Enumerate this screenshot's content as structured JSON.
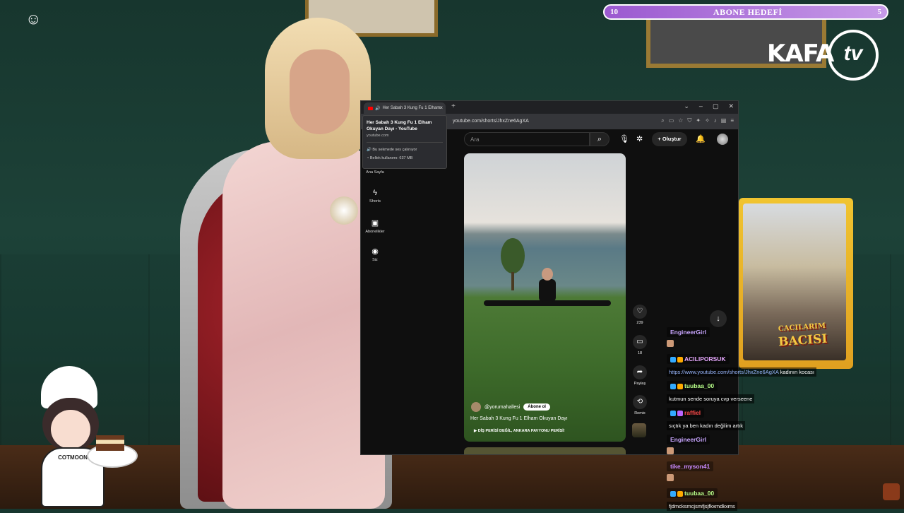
{
  "overlay": {
    "goal": {
      "current": "10",
      "title": "ABONE HEDEFİ",
      "target": "5"
    },
    "logo": {
      "part1": "KAFA",
      "part2": "tv"
    },
    "mascot_label": "COTMOON",
    "poster": {
      "line1": "CACILARIM",
      "line2": "BACISI"
    }
  },
  "browser": {
    "tab_title": "Her Sabah 3 Kung Fu 1 Elham",
    "url": "youtube.com/shorts/JhxZne6AgXA",
    "tooltip": {
      "title": "Her Sabah 3 Kung Fu 1 Elham Okuyan Dayı - YouTube",
      "domain": "youtube.com",
      "audio": "Bu sekmede ses çalınıyor",
      "memory": "Bellek kullanımı: 637 MB"
    }
  },
  "youtube": {
    "search_placeholder": "Ara",
    "create_label": "Oluştur",
    "sidebar": [
      {
        "label": "Ana Sayfa",
        "icon": "home-icon"
      },
      {
        "label": "Shorts",
        "icon": "shorts-icon"
      },
      {
        "label": "Abonelikler",
        "icon": "subscriptions-icon"
      },
      {
        "label": "Siz",
        "icon": "you-icon"
      }
    ],
    "short": {
      "channel": "@yorumahallesi",
      "subscribe": "Abone ol",
      "title": "Her Sabah 3 Kung Fu 1 Elham Okuyan Dayı",
      "song": "DİŞ PERİSİ DEĞİL, ANKARA PAVYONU PERİSİ!"
    },
    "actions": {
      "likes": "239",
      "comments": "18",
      "share": "Paylaş",
      "remix": "Remix"
    }
  },
  "chat": [
    {
      "user": "EngineerGirl",
      "color": "#c9a6ff",
      "text": ""
    },
    {
      "user": "ACILIPORSUK",
      "color": "#e8a9ff",
      "link": "https://www.youtube.com/shorts/JhxZne6AgXA",
      "text": " kadının kocası"
    },
    {
      "user": "tuubaa_00",
      "color": "#b8ff8a",
      "text": "kutmun sende soruya cvp verseene"
    },
    {
      "user": "raffiel",
      "color": "#ff4a4a",
      "text": "sıçtık ya ben kadın değilim artık"
    },
    {
      "user": "EngineerGirl",
      "color": "#c9a6ff",
      "text": ""
    },
    {
      "user": "tike_myson41",
      "color": "#c98aff",
      "text": ""
    },
    {
      "user": "tuubaa_00",
      "color": "#b8ff8a",
      "text": "fjdmcksmcjsmfjsjfkxmdkxms"
    }
  ],
  "colors": {
    "goal_bar": "#9b59d0",
    "yt_red": "#ff0000",
    "link": "#9ab8ff"
  }
}
